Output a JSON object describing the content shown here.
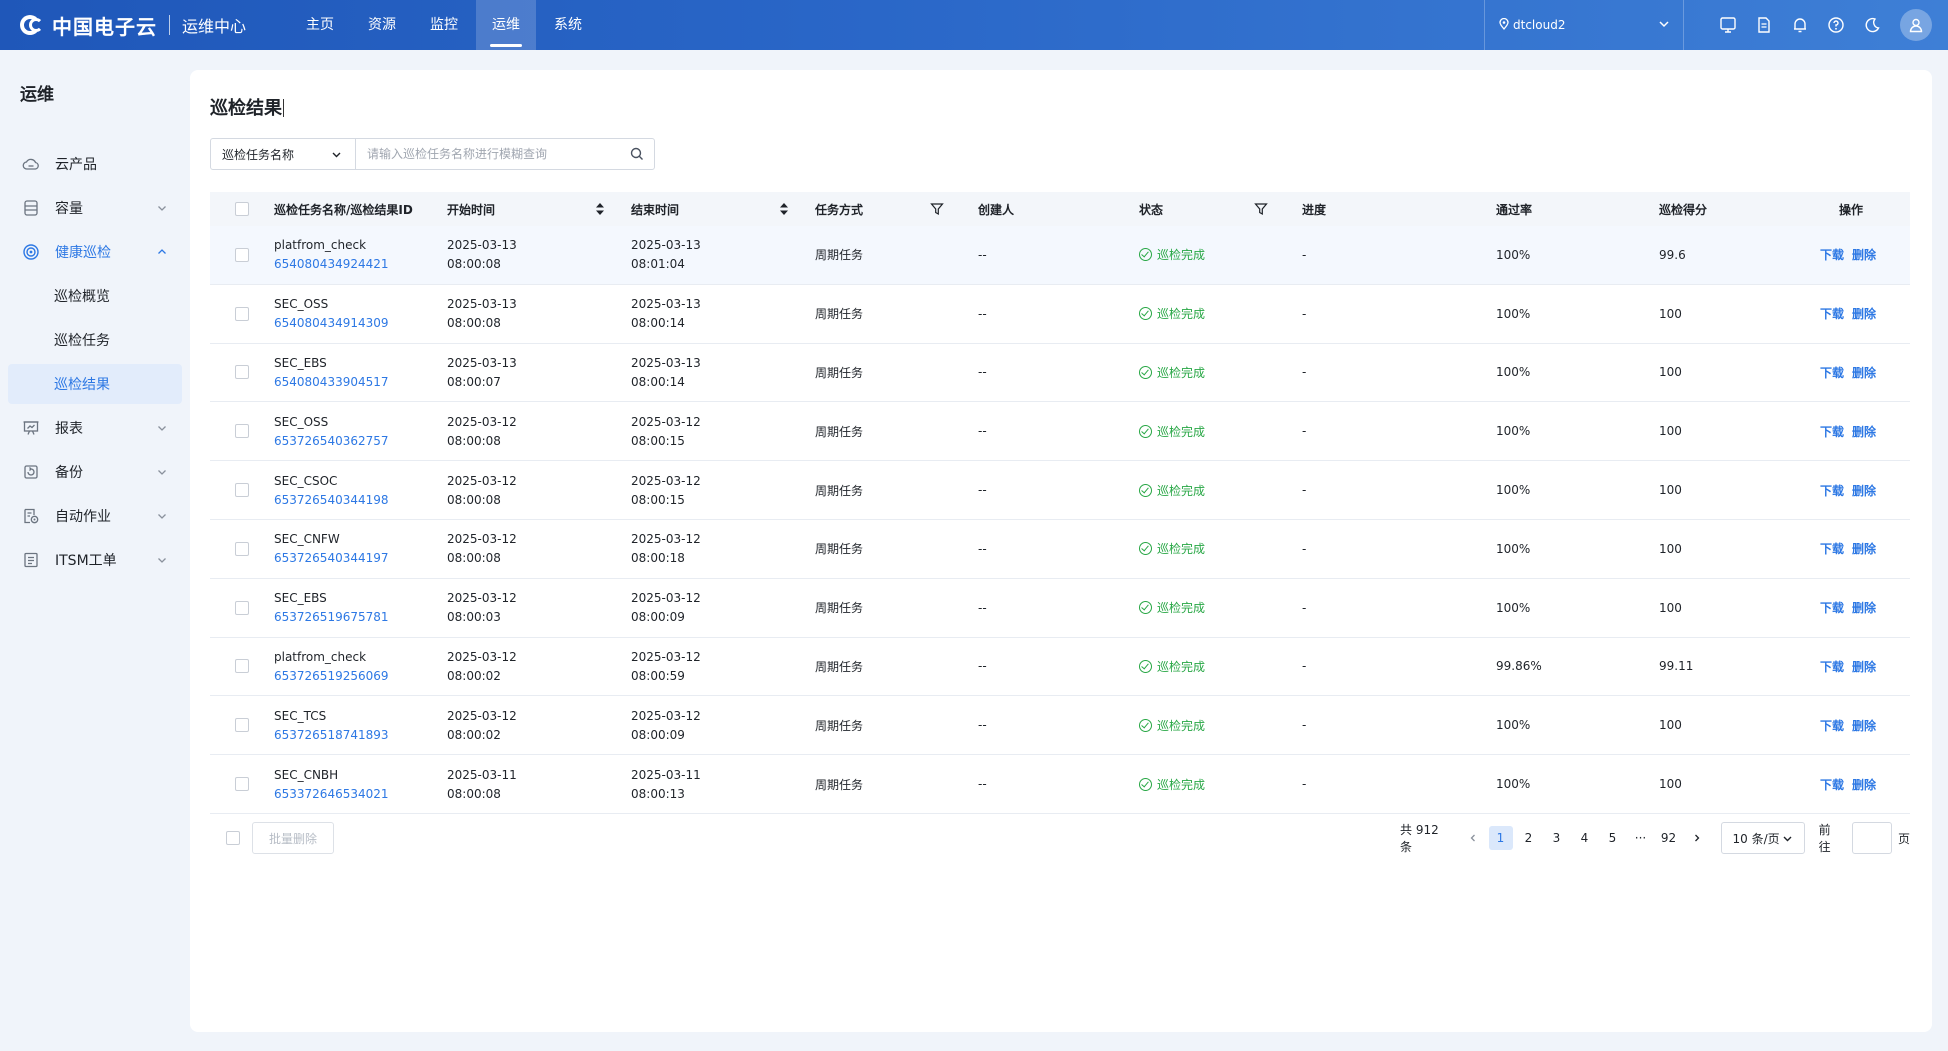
{
  "header": {
    "logo_text": "中国电子云",
    "subtitle": "运维中心",
    "nav": [
      "主页",
      "资源",
      "监控",
      "运维",
      "系统"
    ],
    "nav_active_index": 3,
    "region": "dtcloud2",
    "icons": [
      "screen-icon",
      "document-icon",
      "bell-icon",
      "help-icon",
      "moon-icon"
    ]
  },
  "sidebar": {
    "title": "运维",
    "items": [
      {
        "label": "云产品",
        "icon": "cloud-icon"
      },
      {
        "label": "容量",
        "icon": "database-icon",
        "expandable": true
      },
      {
        "label": "健康巡检",
        "icon": "target-icon",
        "expanded": true
      },
      {
        "label": "巡检概览"
      },
      {
        "label": "巡检任务"
      },
      {
        "label": "巡检结果",
        "active": true
      },
      {
        "label": "报表",
        "icon": "chart-board-icon",
        "expandable": true
      },
      {
        "label": "备份",
        "icon": "backup-icon",
        "expandable": true
      },
      {
        "label": "自动作业",
        "icon": "job-icon",
        "expandable": true
      },
      {
        "label": "ITSM工单",
        "icon": "ticket-icon",
        "expandable": true
      }
    ]
  },
  "main": {
    "title": "巡检结果",
    "search": {
      "select_value": "巡检任务名称",
      "placeholder": "请输入巡检任务名称进行模糊查询"
    },
    "columns": [
      "巡检任务名称/巡检结果ID",
      "开始时间",
      "结束时间",
      "任务方式",
      "创建人",
      "状态",
      "进度",
      "通过率",
      "巡检得分",
      "操作"
    ],
    "rows": [
      {
        "name": "platfrom_check",
        "id": "654080434924421",
        "start_date": "2025-03-13",
        "start_time": "08:00:08",
        "end_date": "2025-03-13",
        "end_time": "08:01:04",
        "mode": "周期任务",
        "creator": "--",
        "status": "巡检完成",
        "progress": "-",
        "pass_rate": "100%",
        "score": "99.6"
      },
      {
        "name": "SEC_OSS",
        "id": "654080434914309",
        "start_date": "2025-03-13",
        "start_time": "08:00:08",
        "end_date": "2025-03-13",
        "end_time": "08:00:14",
        "mode": "周期任务",
        "creator": "--",
        "status": "巡检完成",
        "progress": "-",
        "pass_rate": "100%",
        "score": "100"
      },
      {
        "name": "SEC_EBS",
        "id": "654080433904517",
        "start_date": "2025-03-13",
        "start_time": "08:00:07",
        "end_date": "2025-03-13",
        "end_time": "08:00:14",
        "mode": "周期任务",
        "creator": "--",
        "status": "巡检完成",
        "progress": "-",
        "pass_rate": "100%",
        "score": "100"
      },
      {
        "name": "SEC_OSS",
        "id": "653726540362757",
        "start_date": "2025-03-12",
        "start_time": "08:00:08",
        "end_date": "2025-03-12",
        "end_time": "08:00:15",
        "mode": "周期任务",
        "creator": "--",
        "status": "巡检完成",
        "progress": "-",
        "pass_rate": "100%",
        "score": "100"
      },
      {
        "name": "SEC_CSOC",
        "id": "653726540344198",
        "start_date": "2025-03-12",
        "start_time": "08:00:08",
        "end_date": "2025-03-12",
        "end_time": "08:00:15",
        "mode": "周期任务",
        "creator": "--",
        "status": "巡检完成",
        "progress": "-",
        "pass_rate": "100%",
        "score": "100"
      },
      {
        "name": "SEC_CNFW",
        "id": "653726540344197",
        "start_date": "2025-03-12",
        "start_time": "08:00:08",
        "end_date": "2025-03-12",
        "end_time": "08:00:18",
        "mode": "周期任务",
        "creator": "--",
        "status": "巡检完成",
        "progress": "-",
        "pass_rate": "100%",
        "score": "100"
      },
      {
        "name": "SEC_EBS",
        "id": "653726519675781",
        "start_date": "2025-03-12",
        "start_time": "08:00:03",
        "end_date": "2025-03-12",
        "end_time": "08:00:09",
        "mode": "周期任务",
        "creator": "--",
        "status": "巡检完成",
        "progress": "-",
        "pass_rate": "100%",
        "score": "100"
      },
      {
        "name": "platfrom_check",
        "id": "653726519256069",
        "start_date": "2025-03-12",
        "start_time": "08:00:02",
        "end_date": "2025-03-12",
        "end_time": "08:00:59",
        "mode": "周期任务",
        "creator": "--",
        "status": "巡检完成",
        "progress": "-",
        "pass_rate": "99.86%",
        "score": "99.11"
      },
      {
        "name": "SEC_TCS",
        "id": "653726518741893",
        "start_date": "2025-03-12",
        "start_time": "08:00:02",
        "end_date": "2025-03-12",
        "end_time": "08:00:09",
        "mode": "周期任务",
        "creator": "--",
        "status": "巡检完成",
        "progress": "-",
        "pass_rate": "100%",
        "score": "100"
      },
      {
        "name": "SEC_CNBH",
        "id": "653372646534021",
        "start_date": "2025-03-11",
        "start_time": "08:00:08",
        "end_date": "2025-03-11",
        "end_time": "08:00:13",
        "mode": "周期任务",
        "creator": "--",
        "status": "巡检完成",
        "progress": "-",
        "pass_rate": "100%",
        "score": "100"
      }
    ],
    "row_actions": {
      "download": "下载",
      "delete": "删除"
    },
    "footer": {
      "batch_delete": "批量删除",
      "total": "共 912 条",
      "pages": [
        "1",
        "2",
        "3",
        "4",
        "5",
        "···",
        "92"
      ],
      "current_page": "1",
      "page_size": "10 条/页",
      "goto_label": "前往",
      "page_suffix": "页"
    }
  }
}
